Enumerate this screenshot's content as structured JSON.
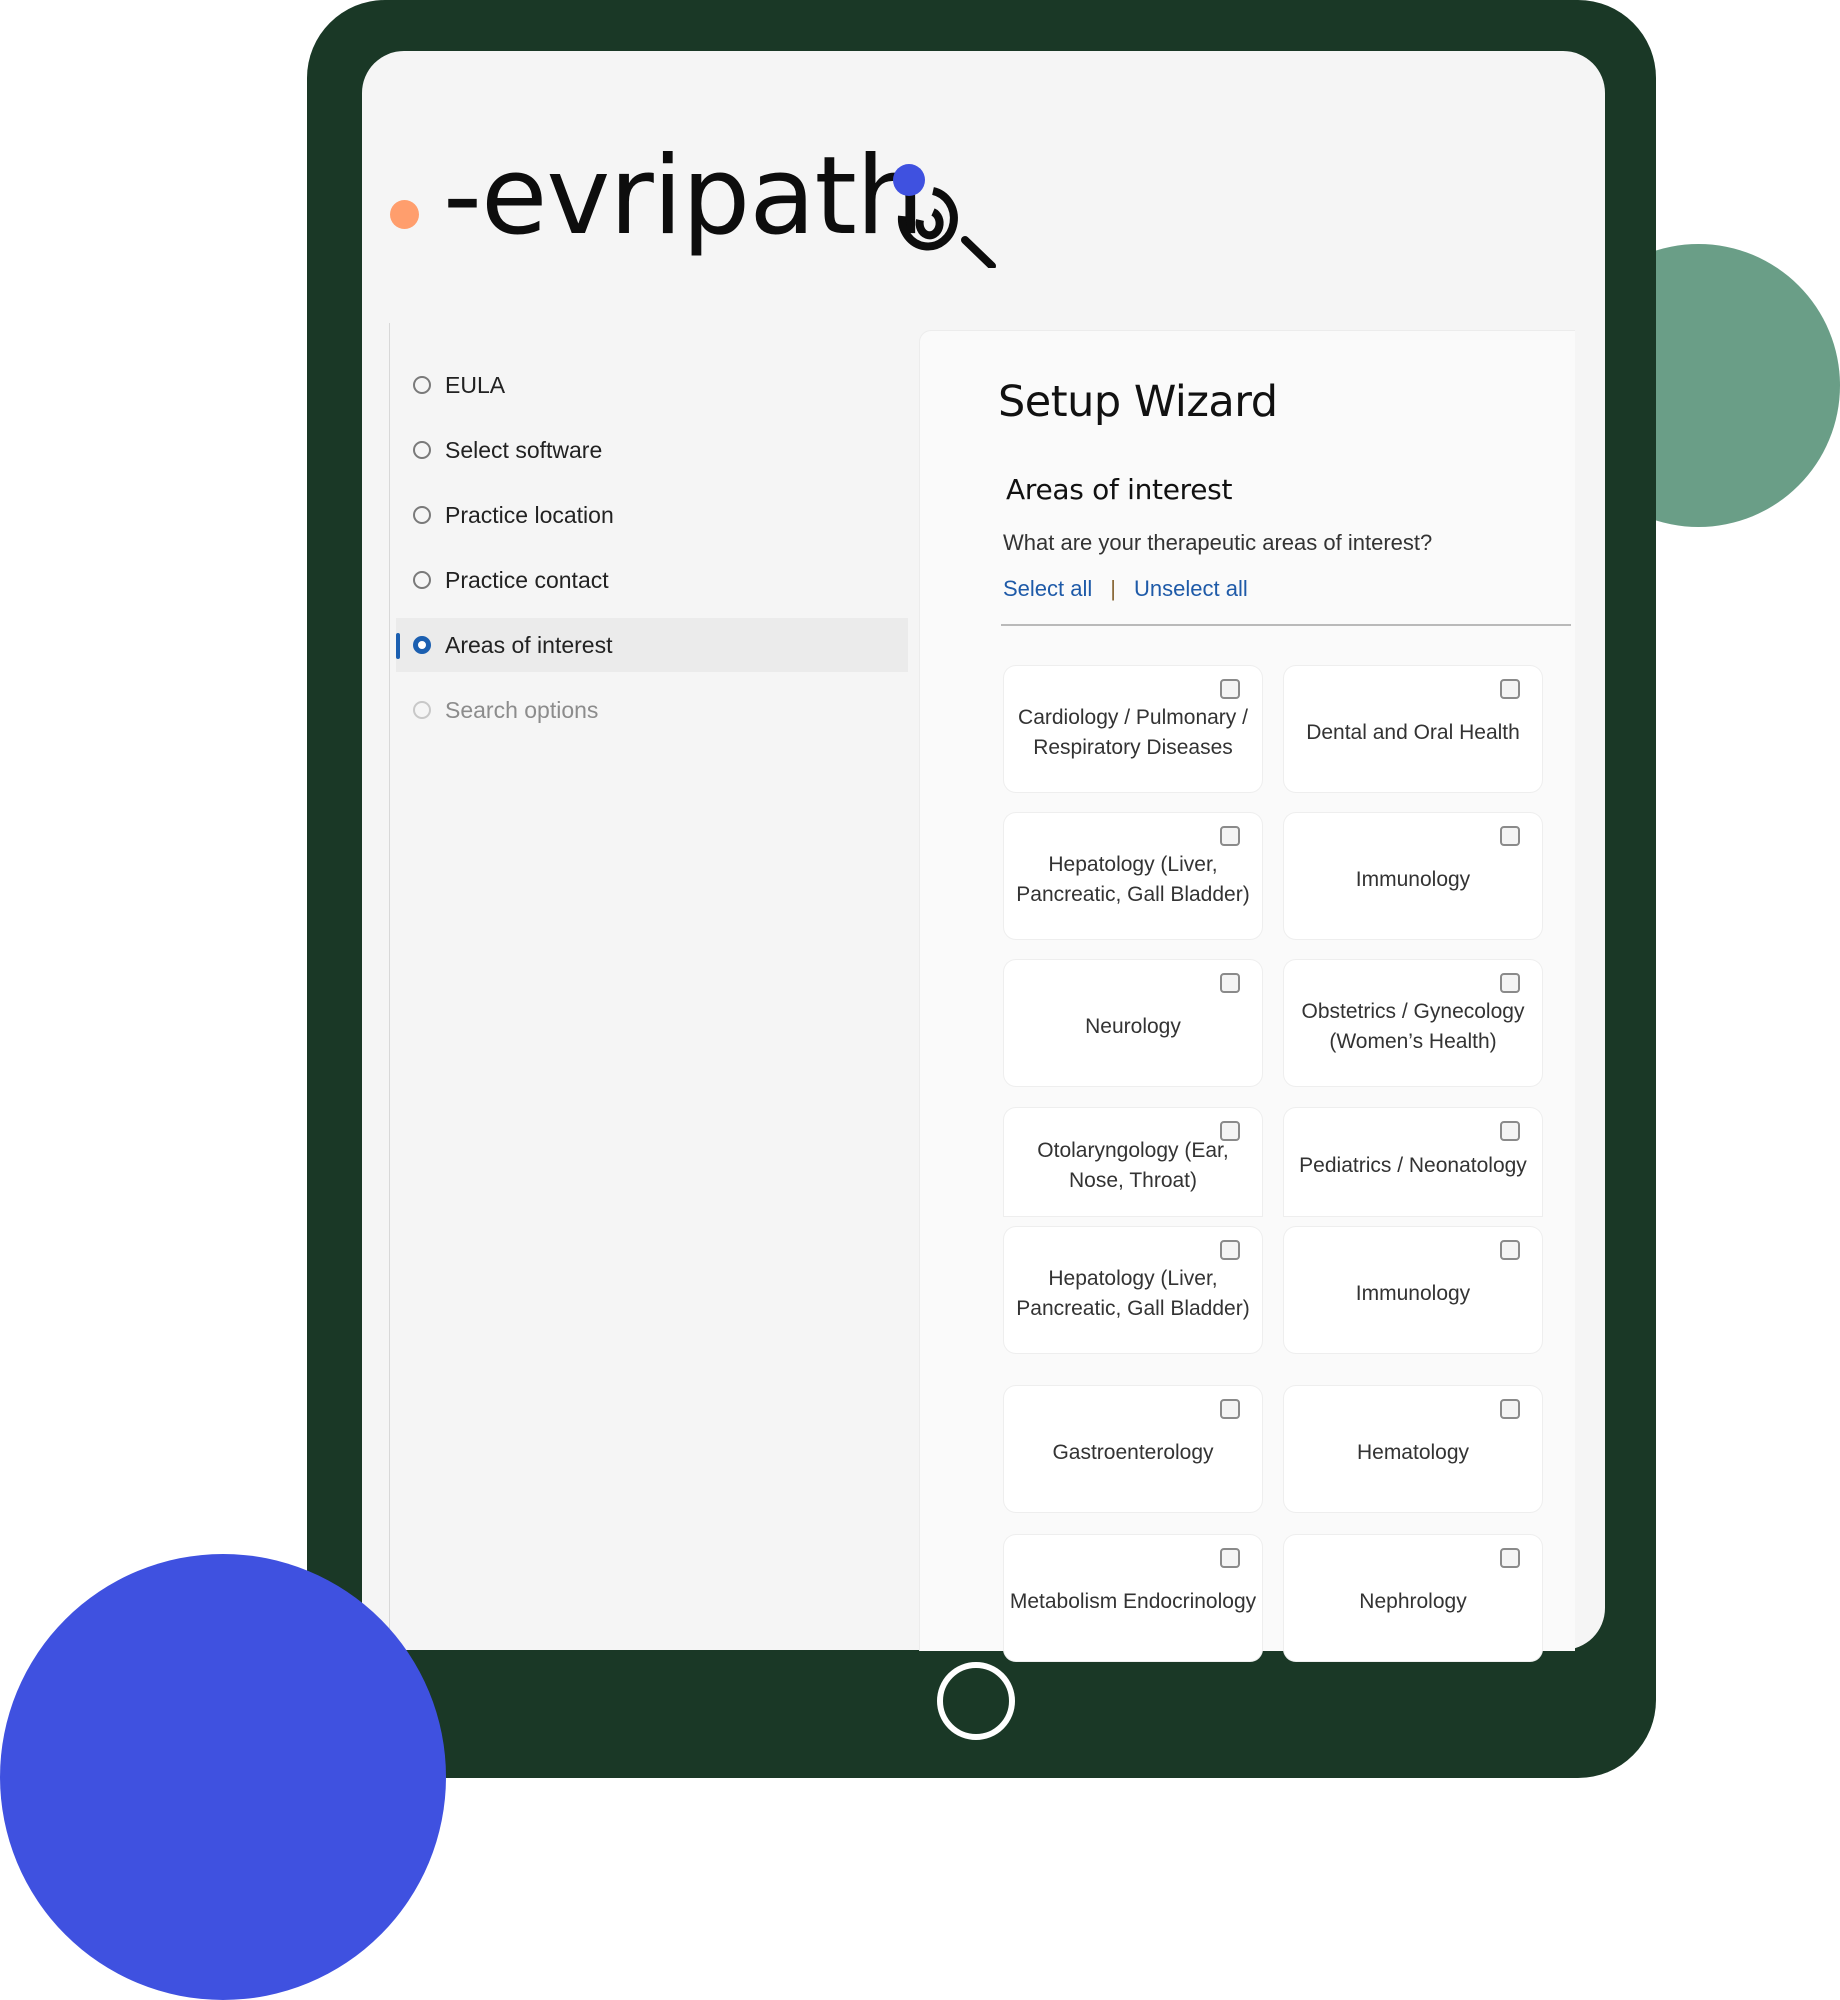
{
  "brand": {
    "name": "-evripath",
    "colors": {
      "orange_dot": "#ff9e6d",
      "blue_dot": "#3f51e0",
      "tablet": "#1a3826",
      "green_accent": "#6a9e87",
      "link": "#1e5aa8",
      "active": "#1b5fb0"
    }
  },
  "sidebar": {
    "steps": [
      {
        "label": "EULA",
        "state": "incomplete"
      },
      {
        "label": "Select software",
        "state": "incomplete"
      },
      {
        "label": "Practice location",
        "state": "incomplete"
      },
      {
        "label": "Practice contact",
        "state": "incomplete"
      },
      {
        "label": "Areas of interest",
        "state": "active"
      },
      {
        "label": "Search options",
        "state": "disabled"
      }
    ]
  },
  "main": {
    "title": "Setup Wizard",
    "section_title": "Areas of interest",
    "question": "What are your therapeutic areas of interest?",
    "select_all": "Select all",
    "separator": "|",
    "unselect_all": "Unselect all",
    "areas": [
      {
        "label": "Cardiology / Pulmonary / Respiratory Diseases",
        "checked": false
      },
      {
        "label": "Dental and Oral Health",
        "checked": false
      },
      {
        "label": "Hepatology (Liver, Pancreatic, Gall Bladder)",
        "checked": false
      },
      {
        "label": "Immunology",
        "checked": false
      },
      {
        "label": "Neurology",
        "checked": false
      },
      {
        "label": "Obstetrics / Gynecology (Women’s Health)",
        "checked": false
      },
      {
        "label": "Otolaryngology (Ear, Nose, Throat)",
        "checked": false
      },
      {
        "label": "Pediatrics / Neonatology",
        "checked": false
      },
      {
        "label": "Hepatology (Liver, Pancreatic, Gall Bladder)",
        "checked": false
      },
      {
        "label": "Immunology",
        "checked": false
      },
      {
        "label": "Gastroenterology",
        "checked": false
      },
      {
        "label": "Hematology",
        "checked": false
      },
      {
        "label": "Metabolism Endocrinology",
        "checked": false
      },
      {
        "label": "Nephrology",
        "checked": false
      }
    ]
  }
}
